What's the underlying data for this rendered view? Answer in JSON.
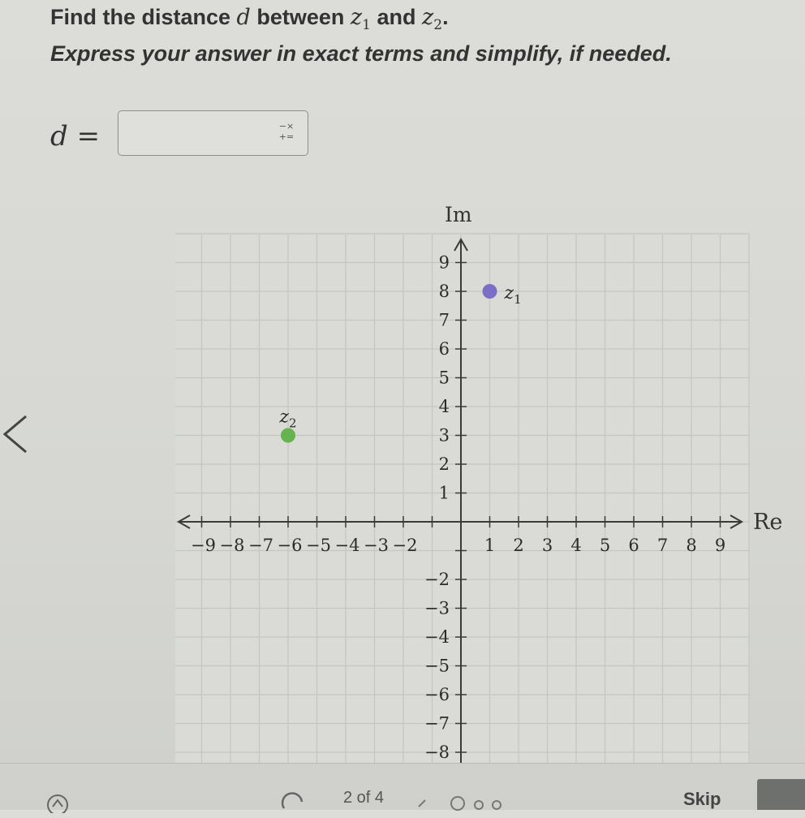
{
  "question": {
    "line1_prefix": "Find the distance",
    "line1_var_d": "d",
    "line1_between": "between",
    "z1_base": "z",
    "z1_sub": "1",
    "line1_and": "and",
    "z2_base": "z",
    "z2_sub": "2",
    "line1_end": ".",
    "line2": "Express your answer in exact terms and simplify, if needed."
  },
  "answer": {
    "label": "d =",
    "value": "",
    "ops_icon_top": "−×",
    "ops_icon_bottom": "+="
  },
  "graph": {
    "im_label": "Im",
    "re_label": "Re",
    "x_ticks_neg": [
      "−9",
      "−8",
      "−7",
      "−6",
      "−5",
      "−4",
      "−3",
      "−2"
    ],
    "x_ticks_pos": [
      "1",
      "2",
      "3",
      "4",
      "5",
      "6",
      "7",
      "8",
      "9"
    ],
    "y_ticks_pos": [
      "9",
      "8",
      "7",
      "6",
      "5",
      "4",
      "3",
      "2",
      "1"
    ],
    "y_ticks_neg": [
      "−2",
      "−3",
      "−4",
      "−5",
      "−6",
      "−7",
      "−8"
    ],
    "points": [
      {
        "label_base": "z",
        "label_sub": "1",
        "re": 1,
        "im": 8,
        "color": "#7b6ec7"
      },
      {
        "label_base": "z",
        "label_sub": "2",
        "re": -6,
        "im": 3,
        "color": "#66b34f"
      }
    ]
  },
  "footer": {
    "progress": "2 of 4",
    "skip": "Skip"
  },
  "colors": {
    "grid": "#c4c6c2",
    "axis": "#3a3a3a"
  }
}
